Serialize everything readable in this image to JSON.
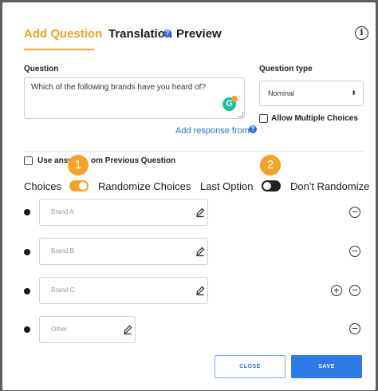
{
  "tabs": [
    {
      "label": "Add Question",
      "active": true
    },
    {
      "label": "Translation",
      "help": "?"
    },
    {
      "label": "Preview"
    }
  ],
  "info_icon": "info-icon",
  "question": {
    "label": "Question",
    "value": "Which of the following brands have you heard of?",
    "grammarly_icon": "G"
  },
  "question_type": {
    "label": "Question type",
    "selected": "Nominal",
    "arrow": "⬍"
  },
  "allow_multiple": {
    "label": "Allow Multiple Choices",
    "checked": false
  },
  "add_response": {
    "label": "Add response from",
    "help": "?"
  },
  "use_answers": {
    "label_start": "Use answ",
    "label_end": "om Previous Question",
    "checked": false
  },
  "choices_row": {
    "choices_label": "Choices",
    "randomize_label": "Randomize Choices",
    "randomize_on": true,
    "last_option_label": "Last Option",
    "last_option_on": false,
    "dont_randomize_label": "Don't Randomize"
  },
  "markers": [
    "1",
    "2"
  ],
  "choices": [
    {
      "placeholder": "Brand A"
    },
    {
      "placeholder": "Brand B"
    },
    {
      "placeholder": "Brand C"
    },
    {
      "placeholder": "Other"
    }
  ],
  "buttons": {
    "close": "CLOSE",
    "save": "SAVE"
  },
  "colors": {
    "accent": "#f3a325",
    "primary": "#2d7be6",
    "link": "#2d6fd8",
    "toggle_off": "#222222"
  }
}
